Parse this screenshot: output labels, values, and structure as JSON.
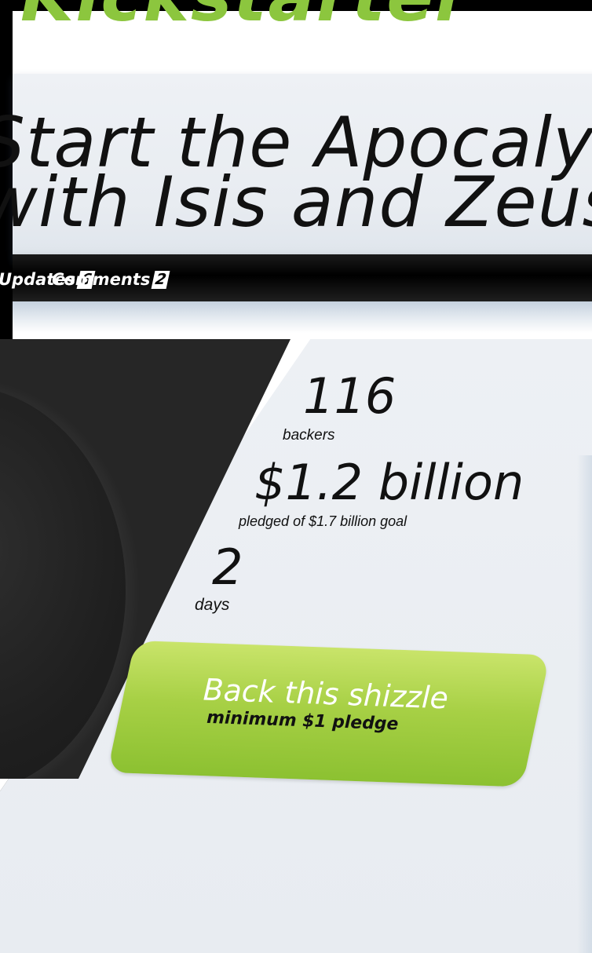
{
  "site": {
    "logo_text": "Kickstarter",
    "logo_color": "#8cc63e"
  },
  "title": {
    "line1": "Start the Apocalypse",
    "line2": "with Isis and Zeus!!!"
  },
  "nav": {
    "updates_label": "Updates",
    "updates_count": "6",
    "comments_label": "Comments",
    "comments_count": "2"
  },
  "stats": {
    "backers_value": "116",
    "backers_label": "backers",
    "pledged_value": "$1.2 billion",
    "pledged_label": "pledged of $1.7 billion goal",
    "days_value": "2",
    "days_label": "days"
  },
  "back_button": {
    "title": "Back this shizzle",
    "subtitle": "minimum $1 pledge",
    "color": "#a7d045"
  },
  "colors": {
    "page_bg": "#000000",
    "banner_bg": "#eef1f5",
    "nav_bg": "#000000",
    "accent_green": "#8cc63e"
  }
}
